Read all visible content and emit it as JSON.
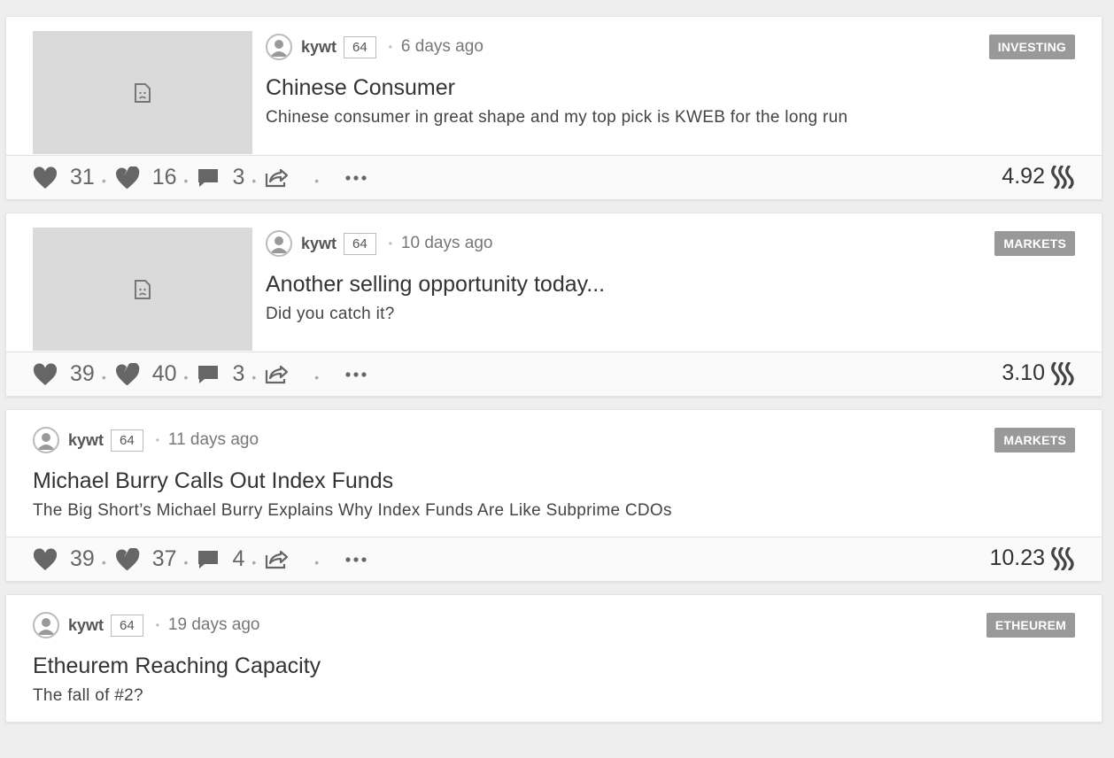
{
  "posts": [
    {
      "author": "kywt",
      "reputation": "64",
      "time": "6 days ago",
      "tag": "INVESTING",
      "title": "Chinese Consumer",
      "summary": "Chinese consumer in great shape and my top pick is KWEB for the long run",
      "has_thumbnail": true,
      "upvotes": "31",
      "downvotes": "16",
      "comments": "3",
      "payout": "4.92"
    },
    {
      "author": "kywt",
      "reputation": "64",
      "time": "10 days ago",
      "tag": "MARKETS",
      "title": "Another selling opportunity today...",
      "summary": "Did you catch it?",
      "has_thumbnail": true,
      "upvotes": "39",
      "downvotes": "40",
      "comments": "3",
      "payout": "3.10"
    },
    {
      "author": "kywt",
      "reputation": "64",
      "time": "11 days ago",
      "tag": "MARKETS",
      "title": "Michael Burry Calls Out Index Funds",
      "summary": "The Big Short’s Michael Burry Explains Why Index Funds Are Like Subprime CDOs",
      "has_thumbnail": false,
      "upvotes": "39",
      "downvotes": "37",
      "comments": "4",
      "payout": "10.23"
    },
    {
      "author": "kywt",
      "reputation": "64",
      "time": "19 days ago",
      "tag": "ETHEUREM",
      "title": "Etheurem Reaching Capacity",
      "summary": "The fall of #2?",
      "has_thumbnail": false
    }
  ],
  "icons": {
    "upvote": "heart-icon",
    "downvote": "broken-heart-icon",
    "comments": "comment-icon",
    "share": "share-icon",
    "more": "more-icon",
    "currency": "steem-icon",
    "thumbnail": "broken-image-icon",
    "avatar": "user-avatar-icon"
  },
  "colors": {
    "background": "#eeeeee",
    "tag_bg": "#999999",
    "thumbnail_bg": "#dadada"
  }
}
